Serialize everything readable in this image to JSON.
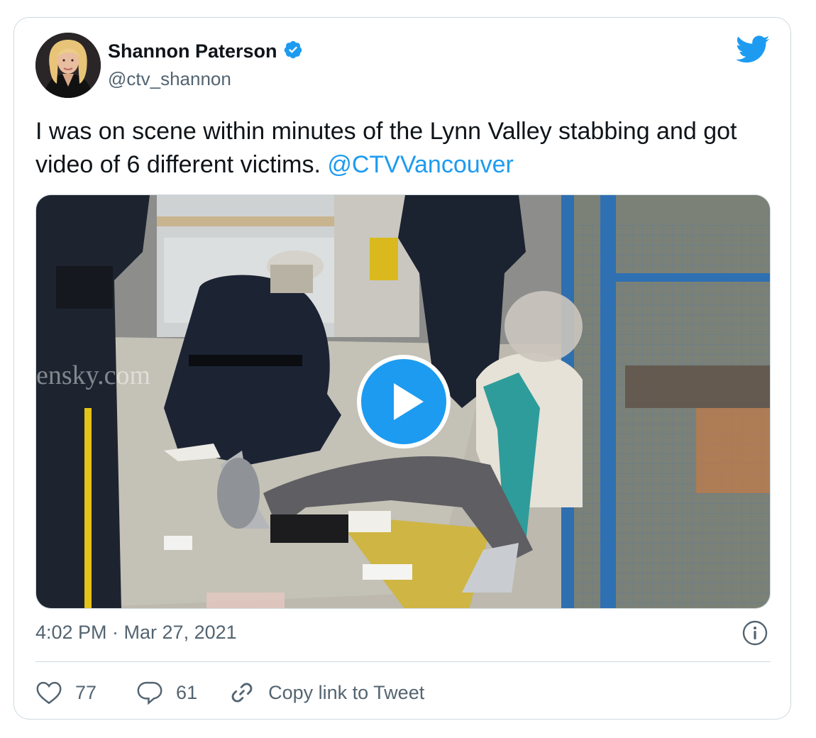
{
  "tweet": {
    "author_name": "Shannon Paterson",
    "handle": "@ctv_shannon",
    "verified": true,
    "text": "I was on scene within minutes of the Lynn Valley stabbing and got video of 6 different victims. ",
    "mention": "@CTVVancouver",
    "timestamp": "4:02 PM · Mar 27, 2021"
  },
  "actions": {
    "likes": "77",
    "replies": "61",
    "copy_link_label": "Copy link to Tweet"
  },
  "icons": {
    "brand": "twitter-bird-icon",
    "verified": "verified-badge-icon",
    "play": "play-icon",
    "info": "info-icon",
    "like": "heart-icon",
    "reply": "reply-bubble-icon",
    "link": "link-icon"
  },
  "colors": {
    "accent": "#1d9bf0",
    "text": "#0f1419",
    "secondary": "#536471",
    "border": "#cfd9de"
  },
  "media": {
    "watermark": "ensky.com"
  }
}
